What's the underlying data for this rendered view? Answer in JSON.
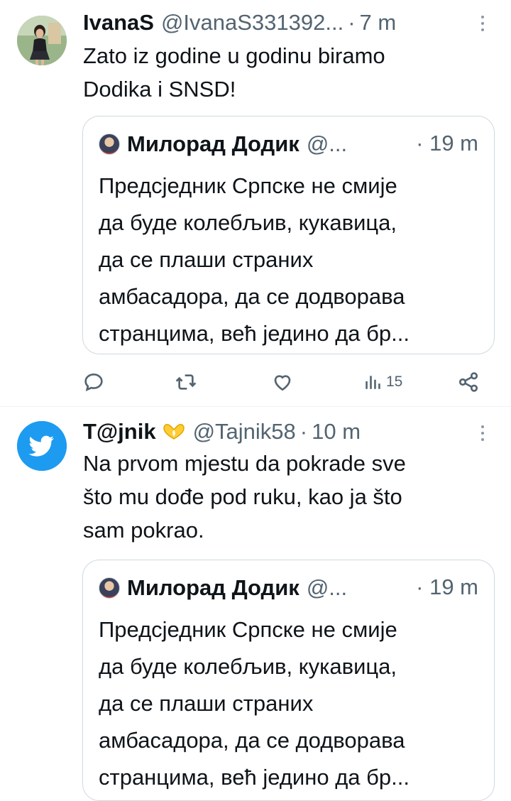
{
  "tweets": [
    {
      "author": {
        "name": "IvanaS",
        "handle": "@IvanaS331392...",
        "avatar": "user-photo-avatar"
      },
      "separator": "·",
      "time": "7 m",
      "text_lines": [
        "Zato iz godine u godinu biramo",
        "Dodika i SNSD!"
      ],
      "quote": {
        "author_name": "Милорад Додик",
        "handle": "@...",
        "time": "· 19 m",
        "text_lines": [
          "Предсједник Српске не смије",
          "да буде колебљив, кукавица,",
          "да се плаши страних",
          "амбасадора, да се додворава",
          "странцима, већ једино да бр..."
        ]
      },
      "actions": {
        "reply_icon": "reply-icon",
        "retweet_icon": "retweet-icon",
        "like_icon": "heart-icon",
        "views_icon": "views-icon",
        "views_count": "15",
        "share_icon": "share-icon"
      }
    },
    {
      "author": {
        "name": "T@jnik",
        "handle": "@Tajnik58",
        "avatar": "twitter-bird-avatar",
        "badge": "heart-hands-emoji"
      },
      "separator": "·",
      "time": "10 m",
      "text_lines": [
        "Na prvom mjestu da pokrade sve",
        "što mu dođe pod ruku, kao ja što",
        "sam pokrao."
      ],
      "quote": {
        "author_name": "Милорад Додик",
        "handle": "@...",
        "time": "· 19 m",
        "text_lines": [
          "Предсједник Српске не смије",
          "да буде колебљив, кукавица,",
          "да се плаши страних",
          "амбасадора, да се додворава",
          "странцима, већ једино да бр..."
        ]
      }
    }
  ],
  "colors": {
    "text": "#0f1419",
    "secondary": "#536471",
    "border": "#cfd9de",
    "twitter_blue": "#1d9bf0"
  }
}
